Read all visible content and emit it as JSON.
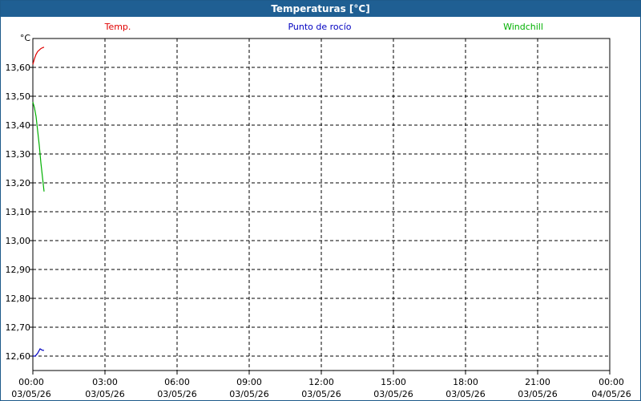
{
  "window": {
    "title": "Temperaturas [°C]"
  },
  "colors": {
    "title_bar": "#1f5f93",
    "temp": "#e00000",
    "dew": "#0000c0",
    "windchill": "#00b000",
    "grid": "#000000"
  },
  "chart_data": {
    "type": "line",
    "title": "Temperaturas [°C]",
    "ylabel": "°C",
    "ylim": [
      12.55,
      13.7
    ],
    "yticks": [
      "13,60",
      "13,50",
      "13,40",
      "13,30",
      "13,20",
      "13,10",
      "13,00",
      "12,90",
      "12,80",
      "12,70",
      "12,60"
    ],
    "ytick_values": [
      13.6,
      13.5,
      13.4,
      13.3,
      13.2,
      13.1,
      13.0,
      12.9,
      12.8,
      12.7,
      12.6
    ],
    "xlim_minutes": [
      0,
      1440
    ],
    "xticks": [
      {
        "time": "00:00",
        "date": "03/05/26"
      },
      {
        "time": "03:00",
        "date": "03/05/26"
      },
      {
        "time": "06:00",
        "date": "03/05/26"
      },
      {
        "time": "09:00",
        "date": "03/05/26"
      },
      {
        "time": "12:00",
        "date": "03/05/26"
      },
      {
        "time": "15:00",
        "date": "03/05/26"
      },
      {
        "time": "18:00",
        "date": "03/05/26"
      },
      {
        "time": "21:00",
        "date": "03/05/26"
      },
      {
        "time": "00:00",
        "date": "04/05/26"
      }
    ],
    "grid": true,
    "legend_placement": "top",
    "series": [
      {
        "name": "Temp.",
        "color": "#e00000",
        "x_minutes": [
          0,
          4,
          8,
          12,
          16,
          20,
          24,
          28
        ],
        "y": [
          13.61,
          13.63,
          13.645,
          13.655,
          13.66,
          13.665,
          13.668,
          13.67
        ]
      },
      {
        "name": "Punto de rocío",
        "color": "#0000c0",
        "x_minutes": [
          0,
          6,
          12,
          18,
          24,
          28
        ],
        "y": [
          12.6,
          12.6,
          12.61,
          12.625,
          12.62,
          12.62
        ]
      },
      {
        "name": "Windchill",
        "color": "#00b000",
        "x_minutes": [
          0,
          4,
          8,
          12,
          16,
          20,
          24,
          28
        ],
        "y": [
          13.48,
          13.46,
          13.43,
          13.38,
          13.33,
          13.27,
          13.22,
          13.17
        ]
      }
    ]
  }
}
